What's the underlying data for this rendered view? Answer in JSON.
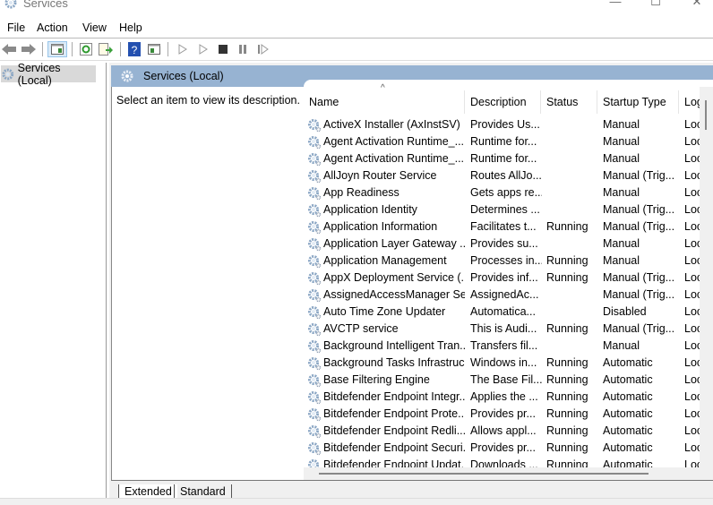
{
  "window": {
    "title": "Services",
    "controls": {
      "minimize": "—",
      "maximize": "☐",
      "close": "✕"
    }
  },
  "menu": [
    "File",
    "Action",
    "View",
    "Help"
  ],
  "toolbar": {
    "buttons": [
      "back",
      "forward",
      "show-hide-console-tree",
      "refresh",
      "export-list",
      "help",
      "show-hide-action-pane",
      "start-service",
      "start-service-alt",
      "stop-service",
      "pause-service",
      "restart-service"
    ]
  },
  "tree": {
    "root": "Services (Local)"
  },
  "main": {
    "header": "Services (Local)",
    "description_prompt": "Select an item to view its description.",
    "columns": [
      "Name",
      "Description",
      "Status",
      "Startup Type",
      "Log"
    ],
    "rows": [
      {
        "name": "ActiveX Installer (AxInstSV)",
        "description": "Provides Us...",
        "status": "",
        "startup": "Manual",
        "log": "Loca"
      },
      {
        "name": "Agent Activation Runtime_...",
        "description": "Runtime for...",
        "status": "",
        "startup": "Manual",
        "log": "Loca"
      },
      {
        "name": "Agent Activation Runtime_...",
        "description": "Runtime for...",
        "status": "",
        "startup": "Manual",
        "log": "Loca"
      },
      {
        "name": "AllJoyn Router Service",
        "description": "Routes AllJo...",
        "status": "",
        "startup": "Manual (Trig...",
        "log": "Loca"
      },
      {
        "name": "App Readiness",
        "description": "Gets apps re...",
        "status": "",
        "startup": "Manual",
        "log": "Loca"
      },
      {
        "name": "Application Identity",
        "description": "Determines ...",
        "status": "",
        "startup": "Manual (Trig...",
        "log": "Loca"
      },
      {
        "name": "Application Information",
        "description": "Facilitates t...",
        "status": "Running",
        "startup": "Manual (Trig...",
        "log": "Loca"
      },
      {
        "name": "Application Layer Gateway ...",
        "description": "Provides su...",
        "status": "",
        "startup": "Manual",
        "log": "Loca"
      },
      {
        "name": "Application Management",
        "description": "Processes in...",
        "status": "Running",
        "startup": "Manual",
        "log": "Loca"
      },
      {
        "name": "AppX Deployment Service (...",
        "description": "Provides inf...",
        "status": "Running",
        "startup": "Manual (Trig...",
        "log": "Loca"
      },
      {
        "name": "AssignedAccessManager Se...",
        "description": "AssignedAc...",
        "status": "",
        "startup": "Manual (Trig...",
        "log": "Loca"
      },
      {
        "name": "Auto Time Zone Updater",
        "description": "Automatica...",
        "status": "",
        "startup": "Disabled",
        "log": "Loca"
      },
      {
        "name": "AVCTP service",
        "description": "This is Audi...",
        "status": "Running",
        "startup": "Manual (Trig...",
        "log": "Loca"
      },
      {
        "name": "Background Intelligent Tran...",
        "description": "Transfers fil...",
        "status": "",
        "startup": "Manual",
        "log": "Loca"
      },
      {
        "name": "Background Tasks Infrastruc...",
        "description": "Windows in...",
        "status": "Running",
        "startup": "Automatic",
        "log": "Loca"
      },
      {
        "name": "Base Filtering Engine",
        "description": "The Base Fil...",
        "status": "Running",
        "startup": "Automatic",
        "log": "Loca"
      },
      {
        "name": "Bitdefender Endpoint Integr...",
        "description": "Applies the ...",
        "status": "Running",
        "startup": "Automatic",
        "log": "Loca"
      },
      {
        "name": "Bitdefender Endpoint Prote...",
        "description": "Provides pr...",
        "status": "Running",
        "startup": "Automatic",
        "log": "Loca"
      },
      {
        "name": "Bitdefender Endpoint Redli...",
        "description": "Allows appl...",
        "status": "Running",
        "startup": "Automatic",
        "log": "Loca"
      },
      {
        "name": "Bitdefender Endpoint Securi...",
        "description": "Provides pr...",
        "status": "Running",
        "startup": "Automatic",
        "log": "Loca"
      },
      {
        "name": "Bitdefender Endpoint Updat...",
        "description": "Downloads ...",
        "status": "Running",
        "startup": "Automatic",
        "log": "Loca"
      }
    ],
    "tabs": [
      "Extended",
      "Standard"
    ],
    "active_tab": "Extended"
  },
  "colors": {
    "header_bar": "#97b3d2",
    "tree_selection": "#d9d9d9",
    "toolbar_active": "#dbeaf7"
  }
}
